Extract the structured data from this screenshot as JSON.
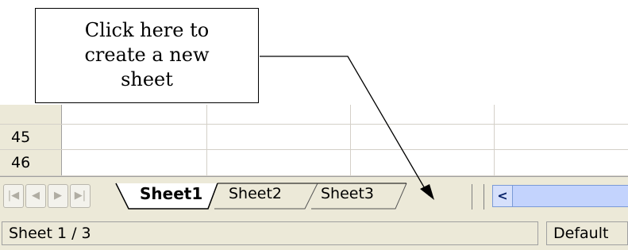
{
  "callout": {
    "lines": [
      "Click here to",
      "create a new",
      "sheet"
    ]
  },
  "rows": [
    {
      "number": "45"
    },
    {
      "number": "46"
    }
  ],
  "navigation": {
    "first_icon": "first-sheet-icon",
    "prev_icon": "previous-sheet-icon",
    "next_icon": "next-sheet-icon",
    "last_icon": "last-sheet-icon"
  },
  "tabs": [
    {
      "label": "Sheet1",
      "active": true
    },
    {
      "label": "Sheet2",
      "active": false
    },
    {
      "label": "Sheet3",
      "active": false
    }
  ],
  "status": {
    "sheet_info": "Sheet 1 / 3",
    "page_style": "Default"
  },
  "colors": {
    "chrome": "#ece9d8",
    "scrollbar": "#c3d3fd",
    "grid": "#d4d0c8"
  }
}
